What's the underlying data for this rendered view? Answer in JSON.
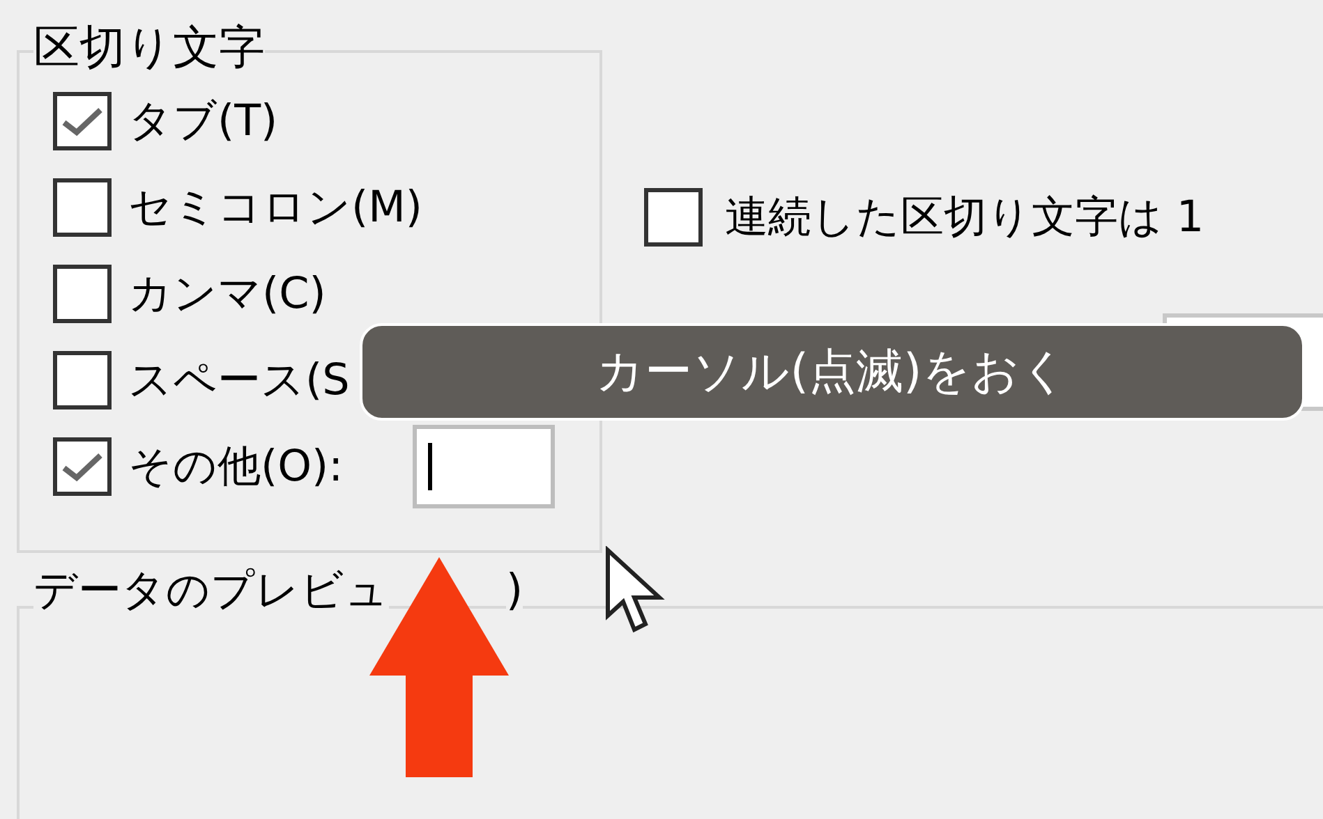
{
  "delimiters": {
    "title": "区切り文字",
    "options": [
      {
        "kind": "plain",
        "label": "タブ(T)",
        "checked": true
      },
      {
        "kind": "plain",
        "label": "セミコロン(M)",
        "checked": false
      },
      {
        "kind": "plain",
        "label": "カンマ(C)",
        "checked": false
      },
      {
        "kind": "plain",
        "label": "スペース(S",
        "checked": false
      },
      {
        "kind": "with_field",
        "label": "その他(O):",
        "checked": true,
        "focused": true
      }
    ]
  },
  "consecutive": {
    "label": "連続した区切り文字は 1",
    "checked": false
  },
  "preview": {
    "title": "データのプレビュ",
    "title_tail": ")"
  },
  "tooltip": {
    "text": "カーソル(点滅)をおく"
  }
}
